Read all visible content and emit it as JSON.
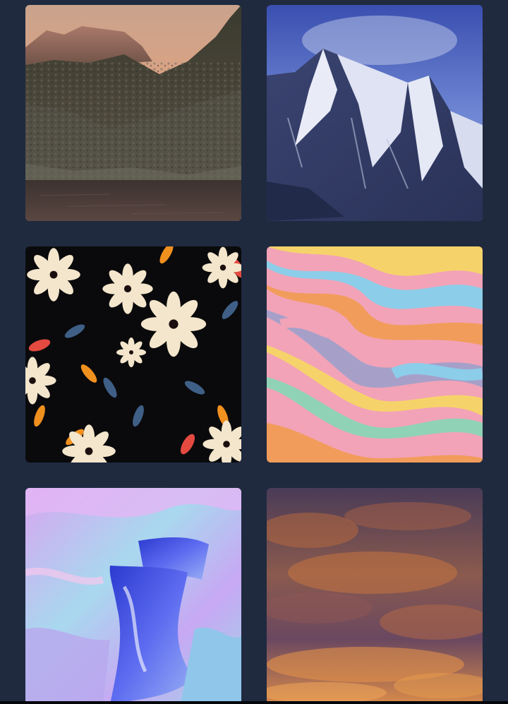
{
  "gallery": {
    "tiles": [
      {
        "name": "wallpaper-tile-mountain-lake-sunset",
        "subject": "mountain-lake-sunset-image"
      },
      {
        "name": "wallpaper-tile-snowy-peaks",
        "subject": "snowy-peaks-image"
      },
      {
        "name": "wallpaper-tile-floral-pattern",
        "subject": "floral-pattern-image"
      },
      {
        "name": "wallpaper-tile-pastel-swirl",
        "subject": "pastel-swirl-image"
      },
      {
        "name": "wallpaper-tile-holographic-fluid",
        "subject": "holographic-fluid-image"
      },
      {
        "name": "wallpaper-tile-orange-clouds",
        "subject": "orange-clouds-image"
      }
    ]
  },
  "colors": {
    "page_background": "#1f2a3f",
    "bottom_strip": "#05070b"
  }
}
